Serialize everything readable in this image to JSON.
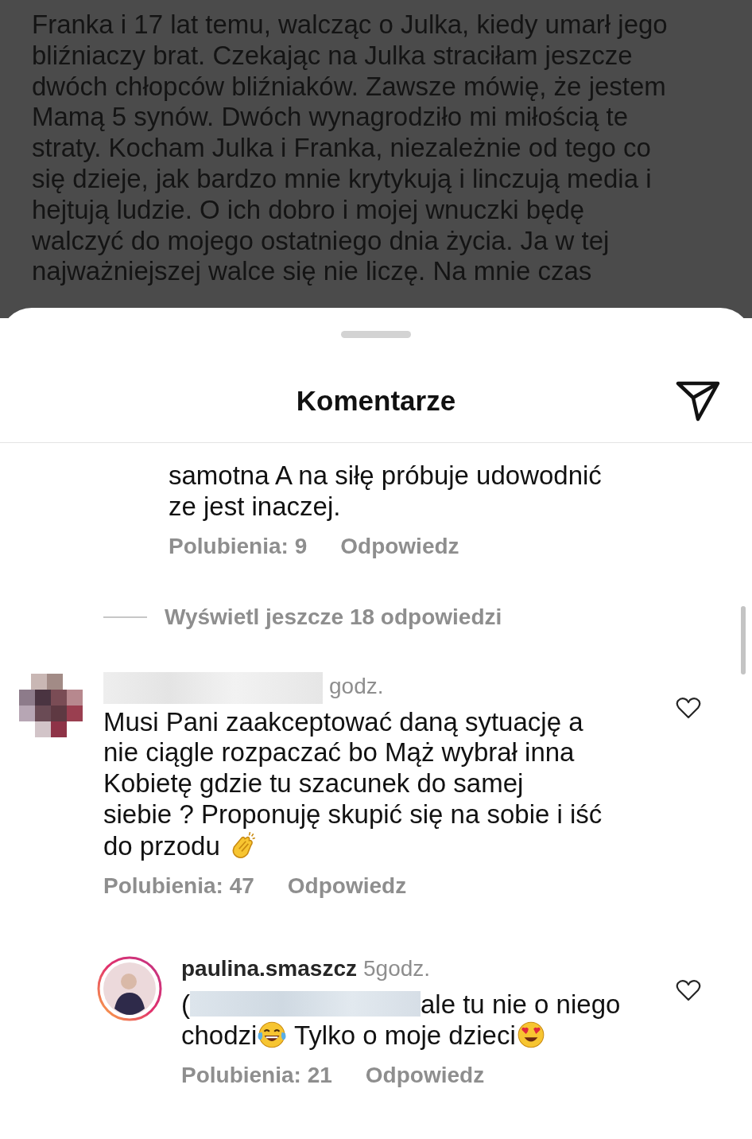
{
  "background_post": {
    "text": "Franka i 17 lat temu, walcząc o Julka, kiedy umarł jego\nbliźniaczy brat. Czekając na Julka straciłam jeszcze\ndwóch chłopców bliźniaków. Zawsze mówię, że jestem\nMamą 5 synów. Dwóch wynagrodziło mi miłością te\nstraty. Kocham Julka i Franka, niezależnie od tego co\nsię dzieje, jak bardzo mnie krytykują i linczują media i\nhejtują ludzie. O ich dobro i mojej wnuczki będę\nwalczyć do mojego ostatniego dnia życia. Ja w tej\nnajważniejszej walce się nie liczę. Na mnie czas"
  },
  "sheet": {
    "title": "Komentarze"
  },
  "comments": [
    {
      "kind": "reply",
      "body": [
        {
          "kind": "text",
          "text": "samotna A na siłę próbuje udowodnić\nze jest inaczej."
        }
      ],
      "likes": "Polubienia: 9",
      "reply_label": "Odpowiedz"
    },
    {
      "kind": "view_more",
      "label": "Wyświetl jeszcze 18 odpowiedzi"
    },
    {
      "kind": "comment",
      "avatar": {
        "kind": "pixelated"
      },
      "author": {
        "kind": "blurred"
      },
      "time": "godz.",
      "liked": false,
      "body": [
        {
          "kind": "text",
          "text": "Musi Pani zaakceptować daną sytuację a\nnie ciągle rozpaczać bo Mąż wybrał inna\nKobietę gdzie tu szacunek do samej\nsiebie ? Proponuję skupić się na sobie i iść\ndo przodu "
        },
        {
          "kind": "clap"
        }
      ],
      "likes": "Polubienia: 47",
      "reply_label": "Odpowiedz"
    },
    {
      "kind": "reply",
      "avatar": {
        "kind": "photo",
        "story_ring": true
      },
      "author": {
        "kind": "name",
        "name": "paulina.smaszcz"
      },
      "time": "5godz.",
      "liked": false,
      "body": [
        {
          "kind": "text",
          "text": "("
        },
        {
          "kind": "blur"
        },
        {
          "kind": "text",
          "text": "ale tu nie o niego\nchodzi"
        },
        {
          "kind": "laugh"
        },
        {
          "kind": "text",
          "text": " Tylko o moje dzieci"
        },
        {
          "kind": "heart_eyes"
        }
      ],
      "likes": "Polubienia: 21",
      "reply_label": "Odpowiedz"
    }
  ]
}
